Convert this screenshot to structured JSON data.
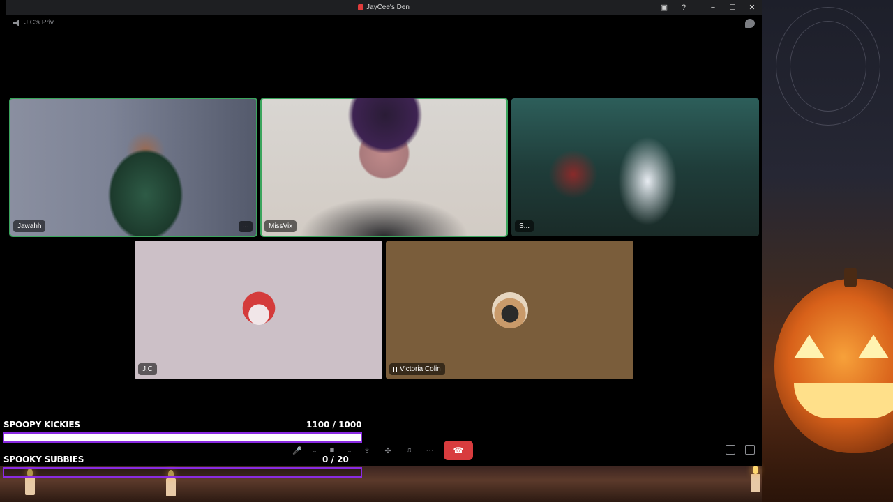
{
  "window": {
    "title": "JayCee's Den"
  },
  "channel": {
    "name": "J.C's Priv"
  },
  "participants": [
    {
      "name": "Jawahh",
      "speaking": true
    },
    {
      "name": "MissVix",
      "speaking": true
    },
    {
      "name": "S...",
      "speaking": false
    },
    {
      "name": "J.C",
      "speaking": false
    },
    {
      "name": "Victoria Colin",
      "speaking": false,
      "mobile": true
    }
  ],
  "tile_more_label": "···",
  "titlebar_buttons": {
    "minimize": "−",
    "maximize": "☐",
    "close": "✕",
    "help": "?"
  },
  "controls": {
    "mic": "🎤",
    "caret": "⌄",
    "camera": "■",
    "share": "⇪",
    "activities": "✣",
    "soundboard": "♫",
    "more": "···",
    "hangup": "☎"
  },
  "goals": [
    {
      "title": "SPOOPY KICKIES",
      "current": "1100",
      "target": "1000",
      "display": "1100  / 1000",
      "progress": 1.0
    },
    {
      "title": "SPOOKY SUBBIES",
      "current": "0",
      "target": "20",
      "display": "0  / 20",
      "progress": 0.0
    }
  ],
  "colors": {
    "speaking_outline": "#3ba55d",
    "hangup": "#d83c3e",
    "goal_border": "#8a2be2",
    "jc_tile": "#ccc0c7",
    "victoria_tile": "#7a5d3b"
  }
}
